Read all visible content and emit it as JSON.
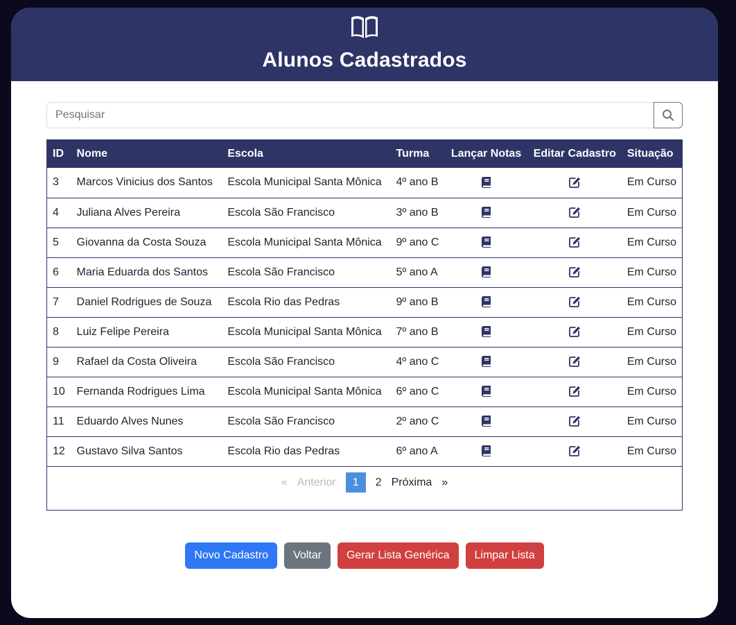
{
  "header": {
    "icon": "book-open-icon",
    "title": "Alunos Cadastrados"
  },
  "search": {
    "placeholder": "Pesquisar",
    "value": "",
    "icon": "search-icon"
  },
  "table": {
    "columns": [
      "ID",
      "Nome",
      "Escola",
      "Turma",
      "Lançar Notas",
      "Editar Cadastro",
      "Situação"
    ],
    "rows": [
      {
        "id": "3",
        "nome": "Marcos Vinicius dos Santos",
        "escola": "Escola Municipal Santa Mônica",
        "turma": "4º ano B",
        "situacao": "Em Curso"
      },
      {
        "id": "4",
        "nome": "Juliana Alves Pereira",
        "escola": "Escola São Francisco",
        "turma": "3º ano B",
        "situacao": "Em Curso"
      },
      {
        "id": "5",
        "nome": "Giovanna da Costa Souza",
        "escola": "Escola Municipal Santa Mônica",
        "turma": "9º ano C",
        "situacao": "Em Curso"
      },
      {
        "id": "6",
        "nome": "Maria Eduarda dos Santos",
        "escola": "Escola São Francisco",
        "turma": "5º ano A",
        "situacao": "Em Curso"
      },
      {
        "id": "7",
        "nome": "Daniel Rodrigues de Souza",
        "escola": "Escola Rio das Pedras",
        "turma": "9º ano B",
        "situacao": "Em Curso"
      },
      {
        "id": "8",
        "nome": "Luiz Felipe Pereira",
        "escola": "Escola Municipal Santa Mônica",
        "turma": "7º ano B",
        "situacao": "Em Curso"
      },
      {
        "id": "9",
        "nome": "Rafael da Costa Oliveira",
        "escola": "Escola São Francisco",
        "turma": "4º ano C",
        "situacao": "Em Curso"
      },
      {
        "id": "10",
        "nome": "Fernanda Rodrigues Lima",
        "escola": "Escola Municipal Santa Mônica",
        "turma": "6º ano C",
        "situacao": "Em Curso"
      },
      {
        "id": "11",
        "nome": "Eduardo Alves Nunes",
        "escola": "Escola São Francisco",
        "turma": "2º ano C",
        "situacao": "Em Curso"
      },
      {
        "id": "12",
        "nome": "Gustavo Silva Santos",
        "escola": "Escola Rio das Pedras",
        "turma": "6º ano A",
        "situacao": "Em Curso"
      }
    ],
    "grades_icon": "book-icon",
    "edit_icon": "edit-icon"
  },
  "pagination": {
    "first": "«",
    "prev": "Anterior",
    "pages": [
      "1",
      "2"
    ],
    "current": "1",
    "next": "Próxima",
    "last": "»"
  },
  "actions": {
    "new": "Novo Cadastro",
    "back": "Voltar",
    "generate": "Gerar Lista Genérica",
    "clear": "Limpar Lista"
  },
  "colors": {
    "header_bg": "#2e3466",
    "primary": "#2f77f5",
    "secondary": "#6c757d",
    "danger": "#d04040",
    "page_active": "#4a90e2"
  }
}
